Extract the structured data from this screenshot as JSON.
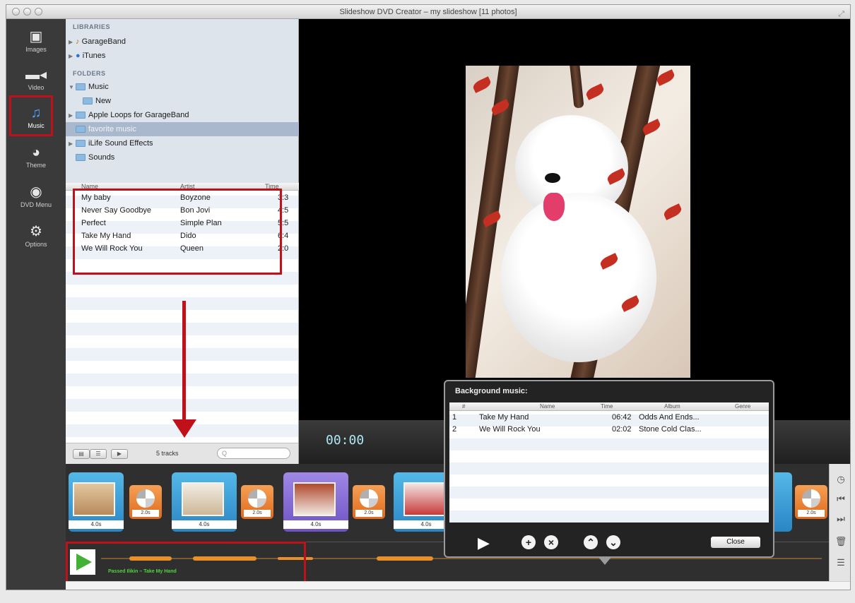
{
  "window": {
    "title": "Slideshow DVD Creator – my slideshow [11 photos]"
  },
  "sidebar": {
    "items": [
      {
        "label": "Images",
        "icon": "image-icon"
      },
      {
        "label": "Video",
        "icon": "video-camera-icon"
      },
      {
        "label": "Music",
        "icon": "music-note-icon"
      },
      {
        "label": "Theme",
        "icon": "palette-icon"
      },
      {
        "label": "DVD Menu",
        "icon": "disc-icon"
      },
      {
        "label": "Options",
        "icon": "gear-icon"
      }
    ],
    "active": "Music"
  },
  "library": {
    "libraries_heading": "LIBRARIES",
    "libraries": [
      "GarageBand",
      "iTunes"
    ],
    "folders_heading": "FOLDERS",
    "folders": [
      "Music",
      "New",
      "Apple Loops for GarageBand",
      "favorite music",
      "iLife Sound Effects",
      "Sounds"
    ],
    "selected_folder": "favorite music"
  },
  "tracks": {
    "columns": [
      "Name",
      "Artist",
      "Time"
    ],
    "rows": [
      {
        "name": "My baby",
        "artist": "Boyzone",
        "time": "3:3"
      },
      {
        "name": "Never Say Goodbye",
        "artist": "Bon Jovi",
        "time": "4:5"
      },
      {
        "name": "Perfect",
        "artist": "Simple Plan",
        "time": "5:5"
      },
      {
        "name": "Take My Hand",
        "artist": "Dido",
        "time": "6:4"
      },
      {
        "name": "We Will Rock You",
        "artist": "Queen",
        "time": "2:0"
      }
    ],
    "count_label": "5 tracks",
    "search_placeholder": "Q"
  },
  "preview": {
    "timer": "00:00"
  },
  "timeline": {
    "clip_duration": "4.0s",
    "transition_duration": "2.0s"
  },
  "audio": {
    "label": "Passed Ilikin – Take My Hand"
  },
  "popup": {
    "title": "Background music:",
    "columns": [
      "#",
      "Name",
      "Time",
      "Album",
      "Genre"
    ],
    "rows": [
      {
        "num": "1",
        "name": "Take My Hand",
        "time": "06:42",
        "album": "Odds And Ends..."
      },
      {
        "num": "2",
        "name": "We Will Rock You",
        "time": "02:02",
        "album": "Stone Cold Clas..."
      }
    ],
    "close_label": "Close"
  },
  "accent_colors": {
    "highlight_red": "#c0101a",
    "music_blue": "#4aa3ff",
    "timer_cyan": "#aee7f2"
  }
}
